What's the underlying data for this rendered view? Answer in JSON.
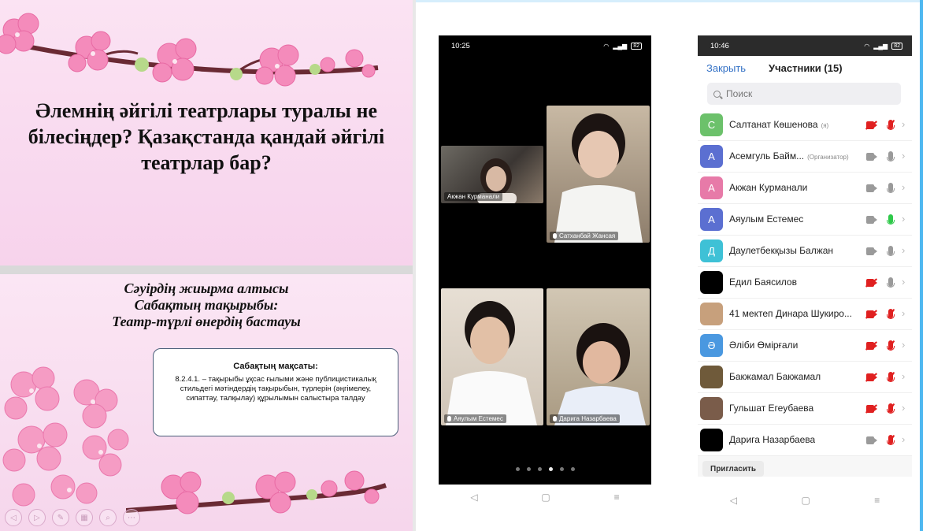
{
  "slide_top": {
    "title": "Әлемнің әйгілі театрлары туралы не білесіңдер? Қазақстанда қандай әйгілі театрлар бар?"
  },
  "slide_bottom": {
    "heading_line1": "Сәуірдің жиырма алтысы",
    "heading_line2": "Сабақтың тақырыбы:",
    "heading_line3": "Театр-түрлі өнердің бастауы",
    "goal_title": "Сабақтың мақсаты:",
    "goal_text": "8.2.4.1. – тақырыбы ұқсас ғылыми және публицистикалық стильдегі мәтіндердің тақырыбын, түрлерін (әңгімелеу, сипаттау, талқылау) құрылымын салыстыра талдау"
  },
  "phone_video": {
    "time": "10:25",
    "battery": "82",
    "tiles": [
      {
        "label": "Акжан Курманали"
      },
      {
        "label": "Сатханбай Жансая"
      },
      {
        "label": "Аяулым Естемес"
      },
      {
        "label": "Дарига Назарбаева"
      }
    ],
    "page_dots": 6,
    "active_dot": 4
  },
  "phone_participants": {
    "time": "10:46",
    "battery": "82",
    "close_label": "Закрыть",
    "title": "Участники (15)",
    "search_placeholder": "Поиск",
    "invite_label": "Пригласить",
    "participants": [
      {
        "initial": "С",
        "name": "Салтанат Көшенова",
        "tag": "(я)",
        "color": "#6cc16b",
        "camera": "off",
        "mic": "off"
      },
      {
        "initial": "А",
        "name": "Асемгуль Байм...",
        "tag": "(Организатор)",
        "color": "#5b6fd1",
        "camera": "on",
        "mic": "muted"
      },
      {
        "initial": "А",
        "name": "Акжан Курманали",
        "tag": "",
        "color": "#e77aa8",
        "camera": "on",
        "mic": "muted"
      },
      {
        "initial": "А",
        "name": "Аяулым Естемес",
        "tag": "",
        "color": "#5b6fd1",
        "camera": "on",
        "mic": "on"
      },
      {
        "initial": "Д",
        "name": "Даулетбекқызы Балжан",
        "tag": "",
        "color": "#3ec1d6",
        "camera": "on",
        "mic": "muted"
      },
      {
        "initial": "",
        "name": "Едил Баясилов",
        "tag": "",
        "color": "#000000",
        "camera": "off",
        "mic": "muted"
      },
      {
        "initial": "",
        "name": "41 мектеп Динара Шукиро...",
        "tag": "",
        "color": "#c7a07c",
        "camera": "off",
        "mic": "off"
      },
      {
        "initial": "Ә",
        "name": "Әліби Өмірғали",
        "tag": "",
        "color": "#4a98e0",
        "camera": "off",
        "mic": "off"
      },
      {
        "initial": "",
        "name": "Бакжамал Бакжамал",
        "tag": "",
        "color": "#6f5a3a",
        "camera": "off",
        "mic": "off"
      },
      {
        "initial": "",
        "name": "Гульшат Егеубаева",
        "tag": "",
        "color": "#7a5c4a",
        "camera": "off",
        "mic": "off"
      },
      {
        "initial": "",
        "name": "Дарига Назарбаева",
        "tag": "",
        "color": "#000000",
        "camera": "on",
        "mic": "off"
      }
    ]
  },
  "colors": {
    "link_blue": "#3572c6",
    "muted_red": "#e02020",
    "active_green": "#2fc94a",
    "slide_pink": "#f7d3ec",
    "frame_blue": "#4fb8f0"
  }
}
